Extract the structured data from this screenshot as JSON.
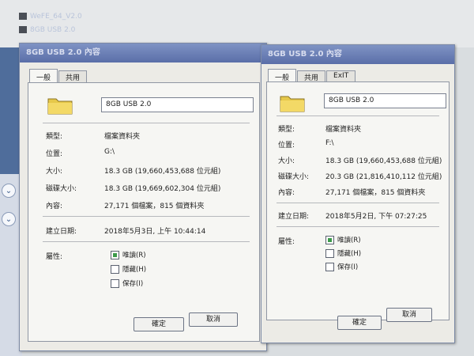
{
  "desktop": {
    "files": [
      "WeFE_64_V2.0",
      "8GB USB 2.0"
    ]
  },
  "left_window": {
    "title": "8GB USB 2.0 內容",
    "tabs": [
      "一般",
      "共用"
    ],
    "name": "8GB USB 2.0",
    "rows": [
      {
        "label": "類型:",
        "value": "檔案資料夾"
      },
      {
        "label": "位置:",
        "value": "G:\\"
      },
      {
        "label": "大小:",
        "value": "18.3 GB (19,660,453,688 位元組)"
      },
      {
        "label": "磁碟大小:",
        "value": "18.3 GB (19,669,602,304 位元組)"
      },
      {
        "label": "內容:",
        "value": "27,171 個檔案，815 個資料夾"
      }
    ],
    "created_label": "建立日期:",
    "created_value": "2018年5月3日, 上午 10:44:14",
    "attributes_label": "屬性:",
    "attributes": [
      {
        "label": "唯讀(R)",
        "checked": true
      },
      {
        "label": "隱藏(H)",
        "checked": false
      },
      {
        "label": "保存(I)",
        "checked": false
      }
    ],
    "buttons": [
      "確定",
      "取消"
    ]
  },
  "right_window": {
    "title": "8GB USB 2.0 內容",
    "tabs": [
      "一般",
      "共用",
      "ExIT"
    ],
    "name": "8GB USB 2.0",
    "rows": [
      {
        "label": "類型:",
        "value": "檔案資料夾"
      },
      {
        "label": "位置:",
        "value": "F:\\"
      },
      {
        "label": "大小:",
        "value": "18.3 GB (19,660,453,688 位元組)"
      },
      {
        "label": "磁碟大小:",
        "value": "20.3 GB (21,816,410,112 位元組)"
      },
      {
        "label": "內容:",
        "value": "27,171 個檔案，815 個資料夾"
      }
    ],
    "created_label": "建立日期:",
    "created_value": "2018年5月2日, 下午 07:27:25",
    "attributes_label": "屬性:",
    "attributes": [
      {
        "label": "唯讀(R)",
        "checked": true
      },
      {
        "label": "隱藏(H)",
        "checked": false
      },
      {
        "label": "保存(I)",
        "checked": false
      }
    ],
    "buttons": [
      "確定",
      "取消"
    ]
  }
}
